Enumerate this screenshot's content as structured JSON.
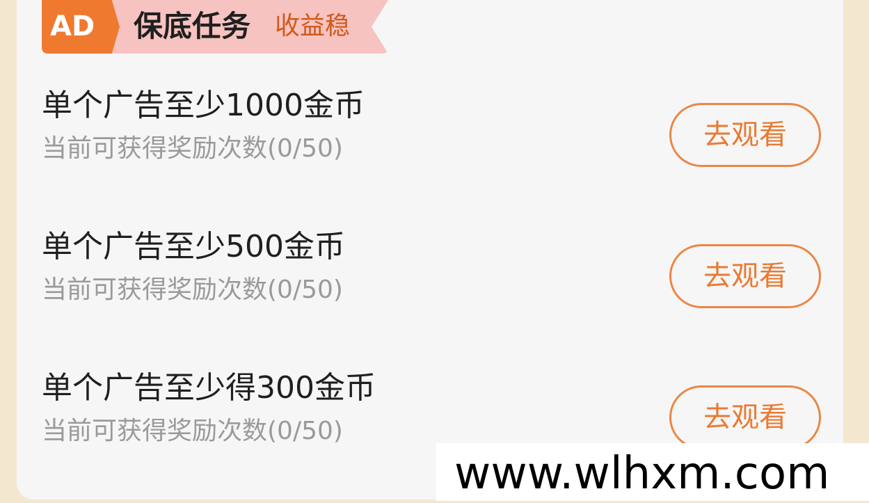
{
  "header": {
    "badge": "AD",
    "title": "保底任务",
    "subtitle": "收益稳"
  },
  "tasks": [
    {
      "title": "单个广告至少1000金币",
      "subtitle": "当前可获得奖励次数(0/50)",
      "button": "去观看"
    },
    {
      "title": "单个广告至少500金币",
      "subtitle": "当前可获得奖励次数(0/50)",
      "button": "去观看"
    },
    {
      "title": "单个广告至少得300金币",
      "subtitle": "当前可获得奖励次数(0/50)",
      "button": "去观看"
    }
  ],
  "watermark": "www.wlhxm.com",
  "colors": {
    "accent": "#ef7a2f",
    "banner": "#f6c3c1",
    "page_background": "#f3e7cf",
    "card_background": "#f6f6f6"
  }
}
